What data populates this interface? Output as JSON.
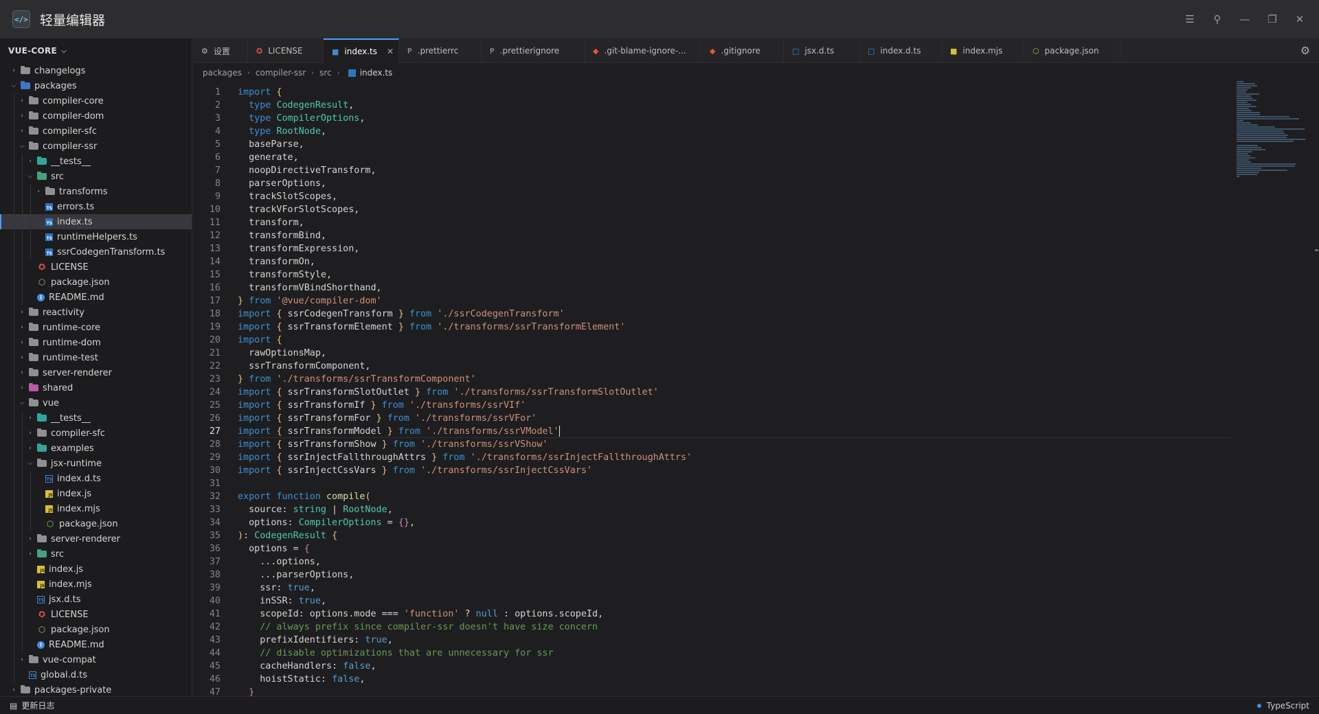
{
  "app": {
    "title": "轻量编辑器",
    "logo_glyph": "</>"
  },
  "window_controls": [
    "menu-icon",
    "pin-icon",
    "minimize-icon",
    "restore-icon",
    "close-icon"
  ],
  "explorer": {
    "root_label": "VUE-CORE"
  },
  "tabs": [
    {
      "label": "设置",
      "icon": "gear-icon"
    },
    {
      "label": "LICENSE",
      "icon": "license-icon"
    },
    {
      "label": "index.ts",
      "icon": "ts-file-icon",
      "active": true
    },
    {
      "label": ".prettierrc",
      "icon": "prettier-icon"
    },
    {
      "label": ".prettierignore",
      "icon": "prettier-icon"
    },
    {
      "label": ".git-blame-ignore-...",
      "icon": "git-icon"
    },
    {
      "label": ".gitignore",
      "icon": "git-icon"
    },
    {
      "label": "jsx.d.ts",
      "icon": "dts-file-icon"
    },
    {
      "label": "index.d.ts",
      "icon": "dts-file-icon"
    },
    {
      "label": "index.mjs",
      "icon": "js-file-icon"
    },
    {
      "label": "package.json",
      "icon": "json-file-icon"
    }
  ],
  "breadcrumb": [
    "packages",
    "compiler-ssr",
    "src",
    "index.ts"
  ],
  "status": {
    "left_label": "更新日志",
    "language": "TypeScript"
  },
  "colors": {
    "accent": "#4c9aff",
    "keyword": "#3d8fd6",
    "type": "#4ec9b0",
    "string": "#ce9178",
    "comment": "#6a9955"
  },
  "tree": [
    {
      "label": "changelogs",
      "depth": 0,
      "kind": "folder",
      "expanded": false
    },
    {
      "label": "packages",
      "depth": 0,
      "kind": "folder-blue",
      "expanded": true
    },
    {
      "label": "compiler-core",
      "depth": 1,
      "kind": "folder",
      "expanded": false
    },
    {
      "label": "compiler-dom",
      "depth": 1,
      "kind": "folder",
      "expanded": false
    },
    {
      "label": "compiler-sfc",
      "depth": 1,
      "kind": "folder",
      "expanded": false
    },
    {
      "label": "compiler-ssr",
      "depth": 1,
      "kind": "folder",
      "expanded": true
    },
    {
      "label": "__tests__",
      "depth": 2,
      "kind": "folder-teal",
      "expanded": false
    },
    {
      "label": "src",
      "depth": 2,
      "kind": "folder-green",
      "expanded": true
    },
    {
      "label": "transforms",
      "depth": 3,
      "kind": "folder",
      "expanded": false
    },
    {
      "label": "errors.ts",
      "depth": 3,
      "kind": "ts"
    },
    {
      "label": "index.ts",
      "depth": 3,
      "kind": "ts",
      "active": true
    },
    {
      "label": "runtimeHelpers.ts",
      "depth": 3,
      "kind": "ts"
    },
    {
      "label": "ssrCodegenTransform.ts",
      "depth": 3,
      "kind": "ts"
    },
    {
      "label": "LICENSE",
      "depth": 2,
      "kind": "license"
    },
    {
      "label": "package.json",
      "depth": 2,
      "kind": "json"
    },
    {
      "label": "README.md",
      "depth": 2,
      "kind": "info"
    },
    {
      "label": "reactivity",
      "depth": 1,
      "kind": "folder",
      "expanded": false
    },
    {
      "label": "runtime-core",
      "depth": 1,
      "kind": "folder",
      "expanded": false
    },
    {
      "label": "runtime-dom",
      "depth": 1,
      "kind": "folder",
      "expanded": false
    },
    {
      "label": "runtime-test",
      "depth": 1,
      "kind": "folder",
      "expanded": false
    },
    {
      "label": "server-renderer",
      "depth": 1,
      "kind": "folder",
      "expanded": false
    },
    {
      "label": "shared",
      "depth": 1,
      "kind": "folder-pink",
      "expanded": false
    },
    {
      "label": "vue",
      "depth": 1,
      "kind": "folder",
      "expanded": true
    },
    {
      "label": "__tests__",
      "depth": 2,
      "kind": "folder-teal",
      "expanded": false
    },
    {
      "label": "compiler-sfc",
      "depth": 2,
      "kind": "folder",
      "expanded": false
    },
    {
      "label": "examples",
      "depth": 2,
      "kind": "folder-teal",
      "expanded": false
    },
    {
      "label": "jsx-runtime",
      "depth": 2,
      "kind": "folder",
      "expanded": true
    },
    {
      "label": "index.d.ts",
      "depth": 3,
      "kind": "dts"
    },
    {
      "label": "index.js",
      "depth": 3,
      "kind": "js"
    },
    {
      "label": "index.mjs",
      "depth": 3,
      "kind": "js"
    },
    {
      "label": "package.json",
      "depth": 3,
      "kind": "json"
    },
    {
      "label": "server-renderer",
      "depth": 2,
      "kind": "folder",
      "expanded": false
    },
    {
      "label": "src",
      "depth": 2,
      "kind": "folder-green",
      "expanded": false
    },
    {
      "label": "index.js",
      "depth": 2,
      "kind": "js"
    },
    {
      "label": "index.mjs",
      "depth": 2,
      "kind": "js"
    },
    {
      "label": "jsx.d.ts",
      "depth": 2,
      "kind": "dts"
    },
    {
      "label": "LICENSE",
      "depth": 2,
      "kind": "license"
    },
    {
      "label": "package.json",
      "depth": 2,
      "kind": "json"
    },
    {
      "label": "README.md",
      "depth": 2,
      "kind": "info"
    },
    {
      "label": "vue-compat",
      "depth": 1,
      "kind": "folder",
      "expanded": false
    },
    {
      "label": "global.d.ts",
      "depth": 1,
      "kind": "dts"
    },
    {
      "label": "packages-private",
      "depth": 0,
      "kind": "folder",
      "expanded": false
    }
  ],
  "editor": {
    "current_line": 27,
    "lines": [
      [
        [
          "k",
          "import"
        ],
        [
          "b",
          " {"
        ]
      ],
      [
        [
          "t",
          "  "
        ],
        [
          "k",
          "type"
        ],
        [
          "t",
          " "
        ],
        [
          "ty",
          "CodegenResult"
        ],
        [
          "t",
          ","
        ]
      ],
      [
        [
          "t",
          "  "
        ],
        [
          "k",
          "type"
        ],
        [
          "t",
          " "
        ],
        [
          "ty",
          "CompilerOptions"
        ],
        [
          "t",
          ","
        ]
      ],
      [
        [
          "t",
          "  "
        ],
        [
          "k",
          "type"
        ],
        [
          "t",
          " "
        ],
        [
          "ty",
          "RootNode"
        ],
        [
          "t",
          ","
        ]
      ],
      [
        [
          "t",
          "  baseParse,"
        ]
      ],
      [
        [
          "t",
          "  generate,"
        ]
      ],
      [
        [
          "t",
          "  noopDirectiveTransform,"
        ]
      ],
      [
        [
          "t",
          "  parserOptions,"
        ]
      ],
      [
        [
          "t",
          "  trackSlotScopes,"
        ]
      ],
      [
        [
          "t",
          "  trackVForSlotScopes,"
        ]
      ],
      [
        [
          "t",
          "  transform,"
        ]
      ],
      [
        [
          "t",
          "  transformBind,"
        ]
      ],
      [
        [
          "t",
          "  transformExpression,"
        ]
      ],
      [
        [
          "t",
          "  transformOn,"
        ]
      ],
      [
        [
          "t",
          "  transformStyle,"
        ]
      ],
      [
        [
          "t",
          "  transformVBindShorthand,"
        ]
      ],
      [
        [
          "b",
          "}"
        ],
        [
          "t",
          " "
        ],
        [
          "k",
          "from"
        ],
        [
          "t",
          " "
        ],
        [
          "s",
          "'@vue/compiler-dom'"
        ]
      ],
      [
        [
          "k",
          "import"
        ],
        [
          "t",
          " "
        ],
        [
          "b",
          "{"
        ],
        [
          "t",
          " ssrCodegenTransform "
        ],
        [
          "b",
          "}"
        ],
        [
          "t",
          " "
        ],
        [
          "k",
          "from"
        ],
        [
          "t",
          " "
        ],
        [
          "s",
          "'./ssrCodegenTransform'"
        ]
      ],
      [
        [
          "k",
          "import"
        ],
        [
          "t",
          " "
        ],
        [
          "b",
          "{"
        ],
        [
          "t",
          " ssrTransformElement "
        ],
        [
          "b",
          "}"
        ],
        [
          "t",
          " "
        ],
        [
          "k",
          "from"
        ],
        [
          "t",
          " "
        ],
        [
          "s",
          "'./transforms/ssrTransformElement'"
        ]
      ],
      [
        [
          "k",
          "import"
        ],
        [
          "t",
          " "
        ],
        [
          "b",
          "{"
        ]
      ],
      [
        [
          "t",
          "  rawOptionsMap,"
        ]
      ],
      [
        [
          "t",
          "  ssrTransformComponent,"
        ]
      ],
      [
        [
          "b",
          "}"
        ],
        [
          "t",
          " "
        ],
        [
          "k",
          "from"
        ],
        [
          "t",
          " "
        ],
        [
          "s",
          "'./transforms/ssrTransformComponent'"
        ]
      ],
      [
        [
          "k",
          "import"
        ],
        [
          "t",
          " "
        ],
        [
          "b",
          "{"
        ],
        [
          "t",
          " ssrTransformSlotOutlet "
        ],
        [
          "b",
          "}"
        ],
        [
          "t",
          " "
        ],
        [
          "k",
          "from"
        ],
        [
          "t",
          " "
        ],
        [
          "s",
          "'./transforms/ssrTransformSlotOutlet'"
        ]
      ],
      [
        [
          "k",
          "import"
        ],
        [
          "t",
          " "
        ],
        [
          "b",
          "{"
        ],
        [
          "t",
          " ssrTransformIf "
        ],
        [
          "b",
          "}"
        ],
        [
          "t",
          " "
        ],
        [
          "k",
          "from"
        ],
        [
          "t",
          " "
        ],
        [
          "s",
          "'./transforms/ssrVIf'"
        ]
      ],
      [
        [
          "k",
          "import"
        ],
        [
          "t",
          " "
        ],
        [
          "b",
          "{"
        ],
        [
          "t",
          " ssrTransformFor "
        ],
        [
          "b",
          "}"
        ],
        [
          "t",
          " "
        ],
        [
          "k",
          "from"
        ],
        [
          "t",
          " "
        ],
        [
          "s",
          "'./transforms/ssrVFor'"
        ]
      ],
      [
        [
          "k",
          "import"
        ],
        [
          "t",
          " "
        ],
        [
          "b",
          "{"
        ],
        [
          "t",
          " ssrTransformModel "
        ],
        [
          "b",
          "}"
        ],
        [
          "t",
          " "
        ],
        [
          "k",
          "from"
        ],
        [
          "t",
          " "
        ],
        [
          "s",
          "'./transforms/ssrVModel'"
        ],
        [
          "cursor",
          ""
        ]
      ],
      [
        [
          "k",
          "import"
        ],
        [
          "t",
          " "
        ],
        [
          "b",
          "{"
        ],
        [
          "t",
          " ssrTransformShow "
        ],
        [
          "b",
          "}"
        ],
        [
          "t",
          " "
        ],
        [
          "k",
          "from"
        ],
        [
          "t",
          " "
        ],
        [
          "s",
          "'./transforms/ssrVShow'"
        ]
      ],
      [
        [
          "k",
          "import"
        ],
        [
          "t",
          " "
        ],
        [
          "b",
          "{"
        ],
        [
          "t",
          " ssrInjectFallthroughAttrs "
        ],
        [
          "b",
          "}"
        ],
        [
          "t",
          " "
        ],
        [
          "k",
          "from"
        ],
        [
          "t",
          " "
        ],
        [
          "s",
          "'./transforms/ssrInjectFallthroughAttrs'"
        ]
      ],
      [
        [
          "k",
          "import"
        ],
        [
          "t",
          " "
        ],
        [
          "b",
          "{"
        ],
        [
          "t",
          " ssrInjectCssVars "
        ],
        [
          "b",
          "}"
        ],
        [
          "t",
          " "
        ],
        [
          "k",
          "from"
        ],
        [
          "t",
          " "
        ],
        [
          "s",
          "'./transforms/ssrInjectCssVars'"
        ]
      ],
      [],
      [
        [
          "k",
          "export"
        ],
        [
          "t",
          " "
        ],
        [
          "k",
          "function"
        ],
        [
          "t",
          " "
        ],
        [
          "f",
          "compile"
        ],
        [
          "b",
          "("
        ]
      ],
      [
        [
          "t",
          "  source: "
        ],
        [
          "ty",
          "string"
        ],
        [
          "t",
          " | "
        ],
        [
          "ty",
          "RootNode"
        ],
        [
          "t",
          ","
        ]
      ],
      [
        [
          "t",
          "  options: "
        ],
        [
          "ty",
          "CompilerOptions"
        ],
        [
          "t",
          " = "
        ],
        [
          "pk",
          "{}"
        ],
        [
          "t",
          ","
        ]
      ],
      [
        [
          "b",
          ")"
        ],
        [
          "t",
          ": "
        ],
        [
          "ty",
          "CodegenResult"
        ],
        [
          "t",
          " "
        ],
        [
          "b",
          "{"
        ]
      ],
      [
        [
          "t",
          "  options = "
        ],
        [
          "pk",
          "{"
        ]
      ],
      [
        [
          "t",
          "    ...options,"
        ]
      ],
      [
        [
          "t",
          "    ...parserOptions,"
        ]
      ],
      [
        [
          "t",
          "    ssr: "
        ],
        [
          "bl",
          "true"
        ],
        [
          "t",
          ","
        ]
      ],
      [
        [
          "t",
          "    inSSR: "
        ],
        [
          "bl",
          "true"
        ],
        [
          "t",
          ","
        ]
      ],
      [
        [
          "t",
          "    scopeId: options.mode === "
        ],
        [
          "s",
          "'function'"
        ],
        [
          "t",
          " ? "
        ],
        [
          "bl",
          "null"
        ],
        [
          "t",
          " : options.scopeId,"
        ]
      ],
      [
        [
          "c",
          "    // always prefix since compiler-ssr doesn't have size concern"
        ]
      ],
      [
        [
          "t",
          "    prefixIdentifiers: "
        ],
        [
          "bl",
          "true"
        ],
        [
          "t",
          ","
        ]
      ],
      [
        [
          "c",
          "    // disable optimizations that are unnecessary for ssr"
        ]
      ],
      [
        [
          "t",
          "    cacheHandlers: "
        ],
        [
          "bl",
          "false"
        ],
        [
          "t",
          ","
        ]
      ],
      [
        [
          "t",
          "    hoistStatic: "
        ],
        [
          "bl",
          "false"
        ],
        [
          "t",
          ","
        ]
      ],
      [
        [
          "t",
          "  "
        ],
        [
          "pk",
          "}"
        ]
      ]
    ]
  }
}
